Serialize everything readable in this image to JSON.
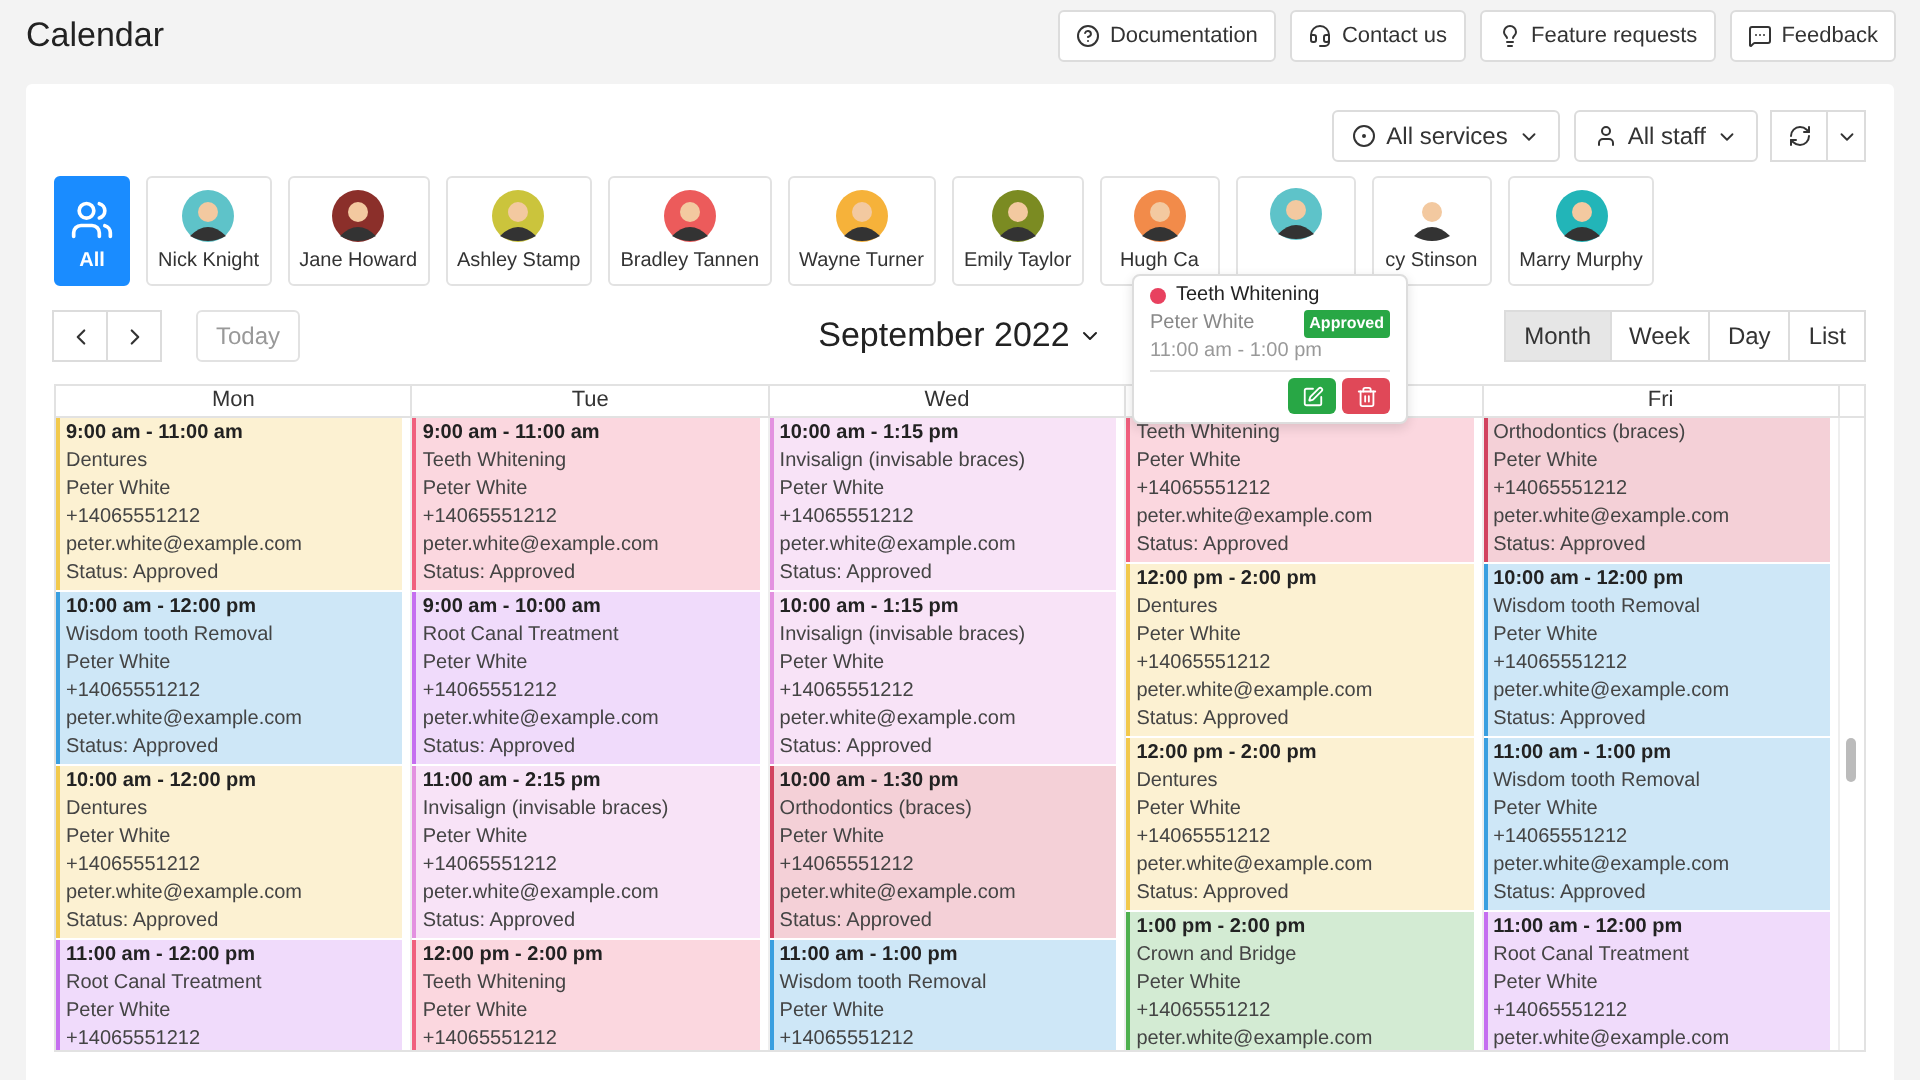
{
  "page": {
    "title": "Calendar"
  },
  "header_buttons": [
    {
      "kind": "help",
      "label": "Documentation"
    },
    {
      "kind": "support",
      "label": "Contact us"
    },
    {
      "kind": "idea",
      "label": "Feature requests"
    },
    {
      "kind": "chat",
      "label": "Feedback"
    }
  ],
  "filters": {
    "services": "All services",
    "staff": "All staff"
  },
  "staff": [
    {
      "kind": "all",
      "name": "All",
      "selected": true
    },
    {
      "kind": "person",
      "name": "Nick Knight",
      "color": "#5ec3c9",
      "selected": false
    },
    {
      "kind": "person",
      "name": "Jane Howard",
      "color": "#8b2f2a",
      "selected": false
    },
    {
      "kind": "person",
      "name": "Ashley Stamp",
      "color": "#cbc43c",
      "selected": false
    },
    {
      "kind": "person",
      "name": "Bradley Tannen",
      "color": "#ec5b5b",
      "selected": false
    },
    {
      "kind": "person",
      "name": "Wayne Turner",
      "color": "#f6b23a",
      "selected": false
    },
    {
      "kind": "person",
      "name": "Emily Taylor",
      "color": "#7b8b22",
      "selected": false
    },
    {
      "kind": "person",
      "name": "Hugh Ca",
      "color": "#f28b4a",
      "selected": false
    },
    {
      "kind": "person",
      "color": "#5ec3c9",
      "selected": false
    },
    {
      "kind": "person",
      "name": "cy Stinson",
      "selected": false
    },
    {
      "kind": "person",
      "name": "Marry Murphy",
      "color": "#22b5b8",
      "selected": false
    }
  ],
  "toolbar": {
    "today": {
      "label": "Today",
      "disabled": true
    },
    "month_title": "September 2022",
    "views": [
      {
        "label": "Month",
        "selected": true
      },
      {
        "label": "Week",
        "selected": false
      },
      {
        "label": "Day",
        "selected": false
      },
      {
        "label": "List",
        "selected": false
      }
    ]
  },
  "calendar": {
    "days": [
      {
        "label": "Mon",
        "events": [
          {
            "color": "#f2c94c",
            "lines": [
              "9:00 am - 11:00 am",
              "Dentures",
              "Peter White",
              "+14065551212",
              "peter.white@example.com",
              "Status: Approved"
            ]
          },
          {
            "color": "#3a9fe0",
            "lines": [
              "10:00 am - 12:00 pm",
              "Wisdom tooth Removal",
              "Peter White",
              "+14065551212",
              "peter.white@example.com",
              "Status: Approved"
            ]
          },
          {
            "color": "#f2c94c",
            "lines": [
              "10:00 am - 12:00 pm",
              "Dentures",
              "Peter White",
              "+14065551212",
              "peter.white@example.com",
              "Status: Approved"
            ]
          },
          {
            "color": "#c56ff0",
            "lines": [
              "11:00 am - 12:00 pm",
              "Root Canal Treatment",
              "Peter White",
              "+14065551212"
            ]
          }
        ]
      },
      {
        "label": "Tue",
        "events": [
          {
            "color": "#f0607e",
            "lines": [
              "9:00 am - 11:00 am",
              "Teeth Whitening",
              "Peter White",
              "+14065551212",
              "peter.white@example.com",
              "Status: Approved"
            ]
          },
          {
            "color": "#c56ff0",
            "lines": [
              "9:00 am - 10:00 am",
              "Root Canal Treatment",
              "Peter White",
              "+14065551212",
              "peter.white@example.com",
              "Status: Approved"
            ]
          },
          {
            "color": "#e391e0",
            "lines": [
              "11:00 am - 2:15 pm",
              "Invisalign (invisable braces)",
              "Peter White",
              "+14065551212",
              "peter.white@example.com",
              "Status: Approved"
            ]
          },
          {
            "color": "#f0607e",
            "lines": [
              "12:00 pm - 2:00 pm",
              "Teeth Whitening",
              "Peter White",
              "+14065551212"
            ]
          }
        ]
      },
      {
        "label": "Wed",
        "events": [
          {
            "color": "#e391e0",
            "lines": [
              "10:00 am - 1:15 pm",
              "Invisalign (invisable braces)",
              "Peter White",
              "+14065551212",
              "peter.white@example.com",
              "Status: Approved"
            ]
          },
          {
            "color": "#e391e0",
            "lines": [
              "10:00 am - 1:15 pm",
              "Invisalign (invisable braces)",
              "Peter White",
              "+14065551212",
              "peter.white@example.com",
              "Status: Approved"
            ]
          },
          {
            "color": "#d2435f",
            "lines": [
              "10:00 am - 1:30 pm",
              "Orthodontics (braces)",
              "Peter White",
              "+14065551212",
              "peter.white@example.com",
              "Status: Approved"
            ]
          },
          {
            "color": "#3a9fe0",
            "lines": [
              "11:00 am - 1:00 pm",
              "Wisdom tooth Removal",
              "Peter White",
              "+14065551212"
            ]
          }
        ]
      },
      {
        "events": [
          {
            "color": "#f0607e",
            "lines": [
              "Teeth Whitening",
              "Peter White",
              "+14065551212",
              "peter.white@example.com",
              "Status: Approved"
            ]
          },
          {
            "color": "#f2c94c",
            "lines": [
              "12:00 pm - 2:00 pm",
              "Dentures",
              "Peter White",
              "+14065551212",
              "peter.white@example.com",
              "Status: Approved"
            ]
          },
          {
            "color": "#f2c94c",
            "lines": [
              "12:00 pm - 2:00 pm",
              "Dentures",
              "Peter White",
              "+14065551212",
              "peter.white@example.com",
              "Status: Approved"
            ]
          },
          {
            "color": "#4fb04f",
            "lines": [
              "1:00 pm - 2:00 pm",
              "Crown and Bridge",
              "Peter White",
              "+14065551212",
              "peter.white@example.com"
            ]
          }
        ]
      },
      {
        "label": "Fri",
        "events": [
          {
            "color": "#d2435f",
            "lines": [
              "Orthodontics (braces)",
              "Peter White",
              "+14065551212",
              "peter.white@example.com",
              "Status: Approved"
            ]
          },
          {
            "color": "#3a9fe0",
            "lines": [
              "10:00 am - 12:00 pm",
              "Wisdom tooth Removal",
              "Peter White",
              "+14065551212",
              "peter.white@example.com",
              "Status: Approved"
            ]
          },
          {
            "color": "#3a9fe0",
            "lines": [
              "11:00 am - 1:00 pm",
              "Wisdom tooth Removal",
              "Peter White",
              "+14065551212",
              "peter.white@example.com",
              "Status: Approved"
            ]
          },
          {
            "color": "#c56ff0",
            "lines": [
              "11:00 am - 12:00 pm",
              "Root Canal Treatment",
              "Peter White",
              "+14065551212",
              "peter.white@example.com"
            ]
          }
        ]
      }
    ]
  },
  "popover": {
    "title": "Teeth Whitening",
    "color": "#e8415f",
    "client": "Peter White",
    "status": "Approved",
    "time": "11:00 am - 1:00 pm"
  }
}
